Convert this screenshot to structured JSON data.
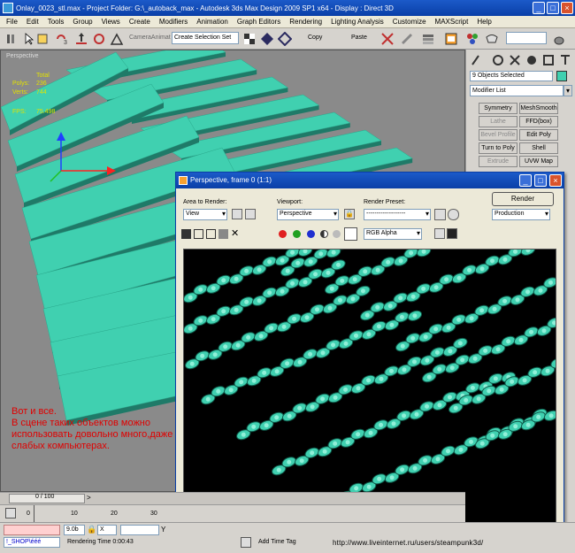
{
  "window": {
    "title": "Onlay_0023_stl.max    - Project Folder: G:\\_autoback_max    - Autodesk 3ds Max Design 2009 SP1  x64    - Display : Direct 3D"
  },
  "menu": [
    "File",
    "Edit",
    "Tools",
    "Group",
    "Views",
    "Create",
    "Modifiers",
    "Animation",
    "Graph Editors",
    "Rendering",
    "Lighting Analysis",
    "Customize",
    "MAXScript",
    "Help"
  ],
  "toolbar": {
    "camera_label": "CameraAnimat",
    "selection_set": "Create Selection Set",
    "copy_label": "Copy",
    "paste_label": "Paste"
  },
  "viewport": {
    "label": "Perspective",
    "stats": {
      "total_label": "Total",
      "polys_label": "Polys:",
      "polys_value": "236",
      "verts_label": "Verts:",
      "verts_value": "744",
      "fps_label": "FPS:",
      "fps_value": "75.498"
    },
    "note": "Вот и все.\nВ сцене таких объектов можно использовать довольно много,даже на слабых компьютерах."
  },
  "command_panel": {
    "selection": "9 Objects Selected",
    "modifier_list": "Modifier List",
    "buttons": [
      {
        "label": "Symmetry",
        "disabled": false
      },
      {
        "label": "MeshSmooth",
        "disabled": false
      },
      {
        "label": "Lathe",
        "disabled": true
      },
      {
        "label": "FFD(box)",
        "disabled": false
      },
      {
        "label": "Bevel Profile",
        "disabled": true
      },
      {
        "label": "Edit Poly",
        "disabled": false
      },
      {
        "label": "Turn to Poly",
        "disabled": false
      },
      {
        "label": "Shell",
        "disabled": false
      },
      {
        "label": "Extrude",
        "disabled": true
      },
      {
        "label": "UVW Map",
        "disabled": false
      }
    ]
  },
  "render_window": {
    "title": "Perspective, frame 0 (1:1)",
    "area_label": "Area to Render:",
    "area_value": "View",
    "viewport_label": "Viewport:",
    "viewport_value": "Perspective",
    "preset_label": "Render Preset:",
    "preset_value": "-------------------",
    "render_button": "Render",
    "production_value": "Production",
    "channel_value": "RGB Alpha"
  },
  "timeline": {
    "frame_label": "0 / 100",
    "ticks": [
      "0",
      "10",
      "20",
      "30"
    ]
  },
  "status": {
    "script_label": "!_SHOP\\ééé",
    "coord_value": "9.0b",
    "render_time": "Rendering Time  0:00:43",
    "add_time_tag": "Add Time Tag",
    "y_label": "Y",
    "watermark": "http://www.liveinternet.ru/users/steampunk3d/"
  },
  "colors": {
    "title_blue": "#0a3fa7",
    "mesh_teal": "#40d0b0",
    "viewport_bg": "#8a8a8a",
    "stat_yellow": "#e2e200",
    "note_red": "#e00000"
  }
}
